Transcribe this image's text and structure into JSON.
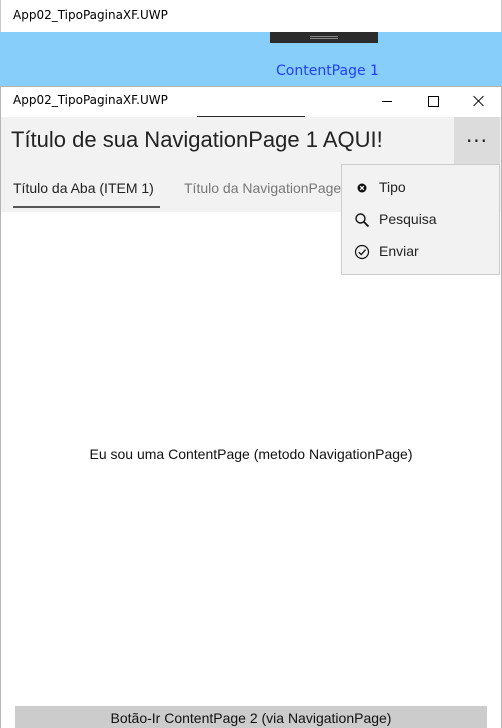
{
  "back_window": {
    "title": "App02_TipoPaginaXF.UWP",
    "content_label": "ContentPage 1"
  },
  "front_window": {
    "title": "App02_TipoPaginaXF.UWP"
  },
  "navigation": {
    "title": "Título de sua NavigationPage 1 AQUI!",
    "more_glyph": "···"
  },
  "tabs": [
    {
      "label": "Título da Aba (ITEM 1)",
      "selected": true
    },
    {
      "label": "Título da NavigationPage",
      "selected": false
    }
  ],
  "menu": {
    "items": [
      {
        "label": "Tipo",
        "icon": "close-circle-icon"
      },
      {
        "label": "Pesquisa",
        "icon": "search-icon"
      },
      {
        "label": "Enviar",
        "icon": "check-circle-icon"
      }
    ]
  },
  "content": {
    "text": "Eu sou uma ContentPage (metodo NavigationPage)"
  },
  "bottom_button": {
    "label": "Botão-Ir ContentPage 2 (via NavigationPage)"
  },
  "colors": {
    "back_content_bg": "#87cefa",
    "back_label": "#1f3fff",
    "nav_bar_bg": "#f2f2f2",
    "button_bg": "#cccccc"
  }
}
